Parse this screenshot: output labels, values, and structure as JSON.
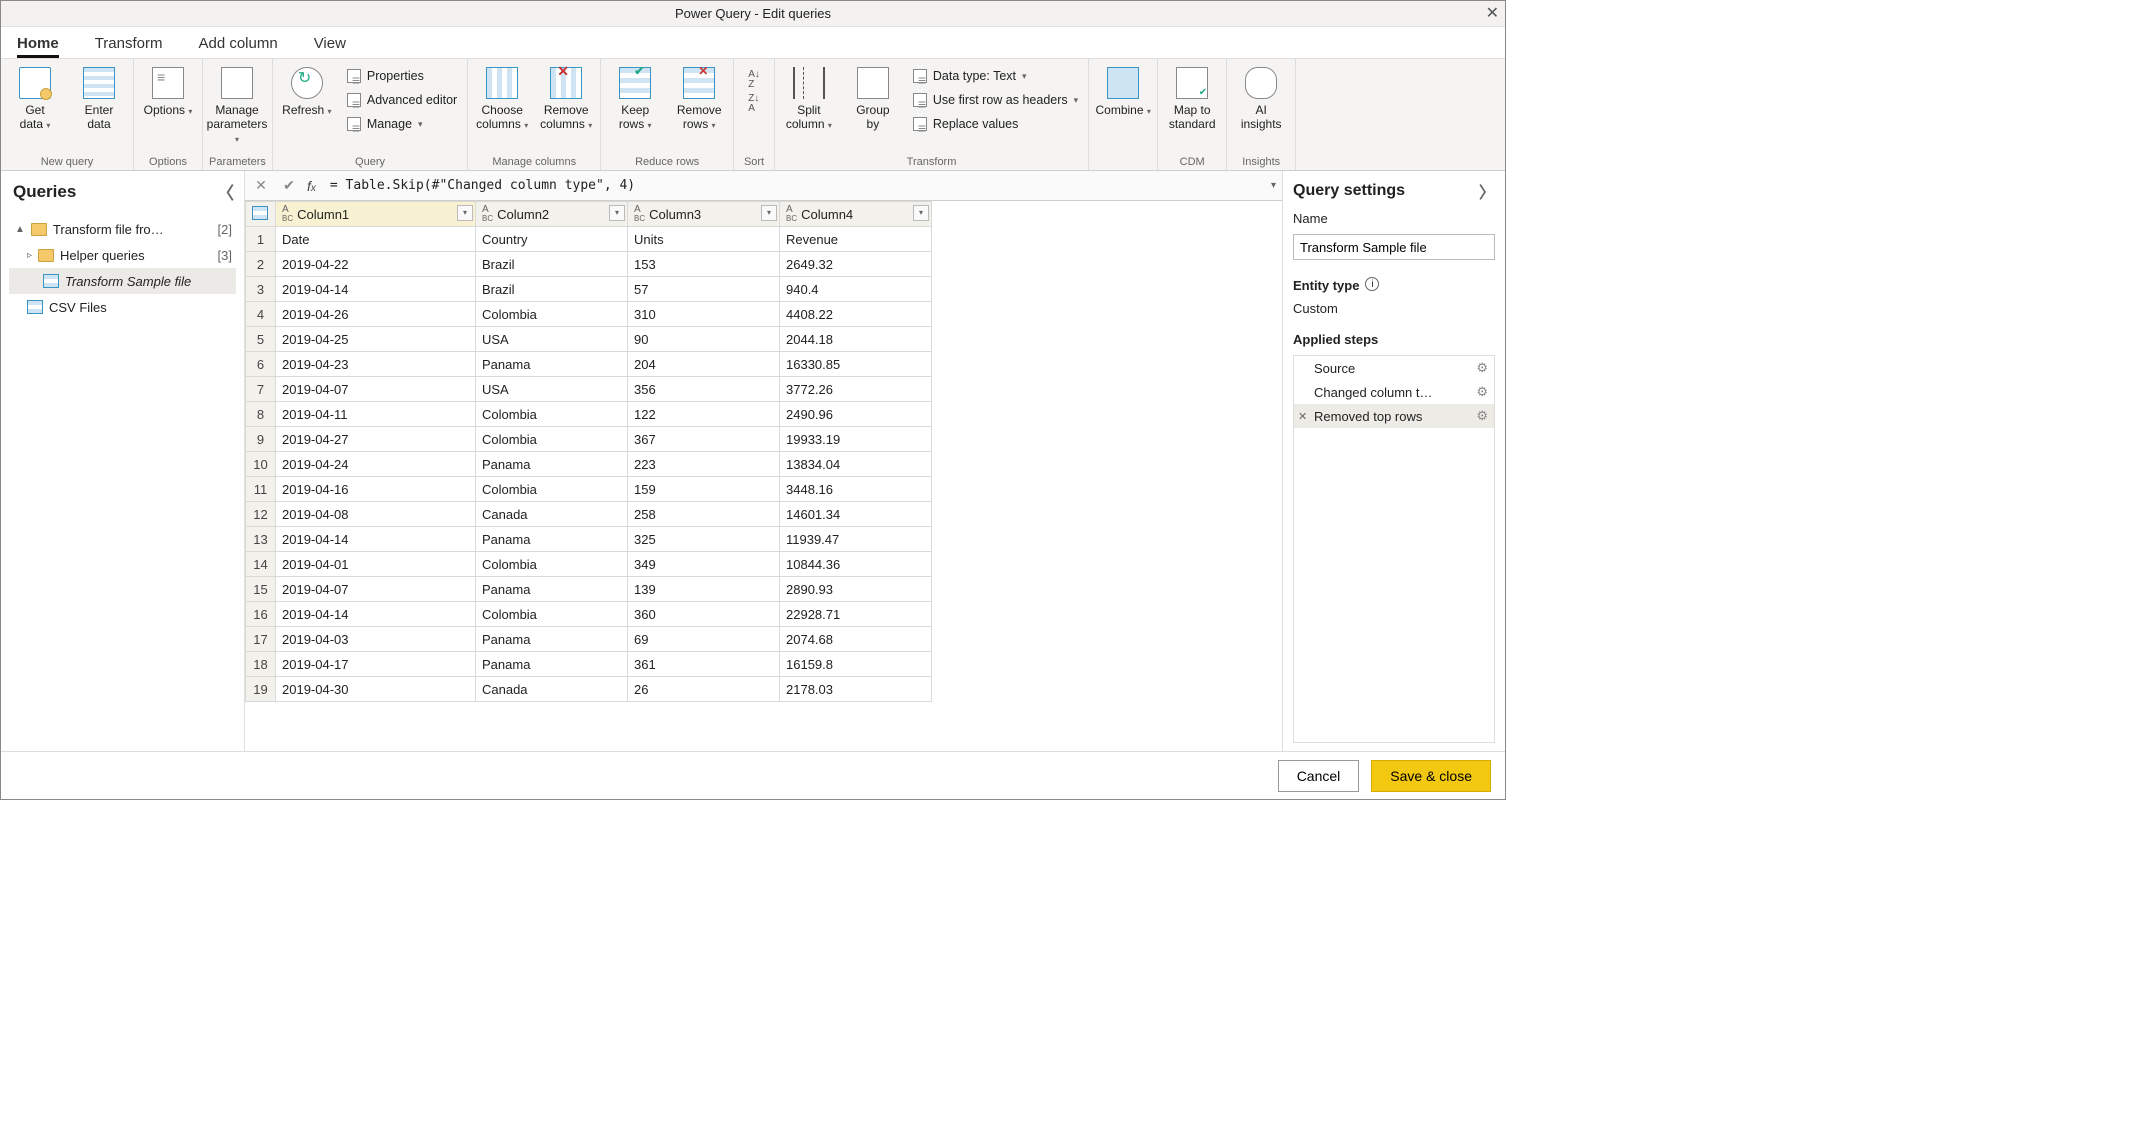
{
  "title": "Power Query - Edit queries",
  "tabs": [
    "Home",
    "Transform",
    "Add column",
    "View"
  ],
  "active_tab": 0,
  "ribbon": {
    "groups": [
      {
        "label": "New query",
        "buttons_lg": [
          {
            "name": "get-data",
            "label": "Get\ndata",
            "chev": true,
            "icon": "ic-db"
          },
          {
            "name": "enter-data",
            "label": "Enter\ndata",
            "icon": "ic-grid"
          }
        ]
      },
      {
        "label": "Options",
        "buttons_lg": [
          {
            "name": "options",
            "label": "Options",
            "chev": true,
            "icon": "ic-doc"
          }
        ]
      },
      {
        "label": "Parameters",
        "buttons_lg": [
          {
            "name": "manage-parameters",
            "label": "Manage\nparameters",
            "chev": true,
            "icon": "ic-sliders"
          }
        ]
      },
      {
        "label": "Query",
        "buttons_lg": [
          {
            "name": "refresh",
            "label": "Refresh",
            "chev": true,
            "icon": "ic-refresh"
          }
        ],
        "buttons_sm": [
          {
            "name": "properties",
            "label": "Properties"
          },
          {
            "name": "advanced-editor",
            "label": "Advanced editor"
          },
          {
            "name": "manage",
            "label": "Manage",
            "chev": true
          }
        ]
      },
      {
        "label": "Manage columns",
        "buttons_lg": [
          {
            "name": "choose-columns",
            "label": "Choose\ncolumns",
            "chev": true,
            "icon": "ic-col"
          },
          {
            "name": "remove-columns",
            "label": "Remove\ncolumns",
            "chev": true,
            "icon": "ic-colx"
          }
        ]
      },
      {
        "label": "Reduce rows",
        "buttons_lg": [
          {
            "name": "keep-rows",
            "label": "Keep\nrows",
            "chev": true,
            "icon": "ic-rows keep"
          },
          {
            "name": "remove-rows",
            "label": "Remove\nrows",
            "chev": true,
            "icon": "ic-rows rem"
          }
        ]
      },
      {
        "label": "Sort",
        "sort": true
      },
      {
        "label": "Transform",
        "buttons_lg": [
          {
            "name": "split-column",
            "label": "Split\ncolumn",
            "chev": true,
            "icon": "ic-split"
          },
          {
            "name": "group-by",
            "label": "Group\nby",
            "icon": "ic-group"
          }
        ],
        "buttons_sm": [
          {
            "name": "data-type",
            "label": "Data type: Text",
            "chev": true
          },
          {
            "name": "use-first-row",
            "label": "Use first row as headers",
            "chev": true
          },
          {
            "name": "replace-values",
            "label": "Replace values"
          }
        ]
      },
      {
        "label": "",
        "buttons_lg": [
          {
            "name": "combine",
            "label": "Combine",
            "chev": true,
            "icon": "ic-combine"
          }
        ]
      },
      {
        "label": "CDM",
        "buttons_lg": [
          {
            "name": "map-to-standard",
            "label": "Map to\nstandard",
            "icon": "ic-map"
          }
        ]
      },
      {
        "label": "Insights",
        "buttons_lg": [
          {
            "name": "ai-insights",
            "label": "AI\ninsights",
            "icon": "ic-ai"
          }
        ]
      }
    ]
  },
  "queries_panel": {
    "title": "Queries",
    "items": [
      {
        "level": 0,
        "type": "folder",
        "label": "Transform file fro…",
        "count": "[2]",
        "exp": "▲"
      },
      {
        "level": 1,
        "type": "folder",
        "label": "Helper queries",
        "count": "[3]",
        "exp": "▹"
      },
      {
        "level": 2,
        "type": "table",
        "label": "Transform Sample file",
        "sel": true
      },
      {
        "level": 1,
        "type": "table",
        "label": "CSV Files"
      }
    ]
  },
  "formula": "= Table.Skip(#\"Changed column type\", 4)",
  "columns": [
    "Column1",
    "Column2",
    "Column3",
    "Column4"
  ],
  "rows": [
    [
      "Date",
      "Country",
      "Units",
      "Revenue"
    ],
    [
      "2019-04-22",
      "Brazil",
      "153",
      "2649.32"
    ],
    [
      "2019-04-14",
      "Brazil",
      "57",
      "940.4"
    ],
    [
      "2019-04-26",
      "Colombia",
      "310",
      "4408.22"
    ],
    [
      "2019-04-25",
      "USA",
      "90",
      "2044.18"
    ],
    [
      "2019-04-23",
      "Panama",
      "204",
      "16330.85"
    ],
    [
      "2019-04-07",
      "USA",
      "356",
      "3772.26"
    ],
    [
      "2019-04-11",
      "Colombia",
      "122",
      "2490.96"
    ],
    [
      "2019-04-27",
      "Colombia",
      "367",
      "19933.19"
    ],
    [
      "2019-04-24",
      "Panama",
      "223",
      "13834.04"
    ],
    [
      "2019-04-16",
      "Colombia",
      "159",
      "3448.16"
    ],
    [
      "2019-04-08",
      "Canada",
      "258",
      "14601.34"
    ],
    [
      "2019-04-14",
      "Panama",
      "325",
      "11939.47"
    ],
    [
      "2019-04-01",
      "Colombia",
      "349",
      "10844.36"
    ],
    [
      "2019-04-07",
      "Panama",
      "139",
      "2890.93"
    ],
    [
      "2019-04-14",
      "Colombia",
      "360",
      "22928.71"
    ],
    [
      "2019-04-03",
      "Panama",
      "69",
      "2074.68"
    ],
    [
      "2019-04-17",
      "Panama",
      "361",
      "16159.8"
    ],
    [
      "2019-04-30",
      "Canada",
      "26",
      "2178.03"
    ]
  ],
  "settings": {
    "title": "Query settings",
    "name_label": "Name",
    "name_value": "Transform Sample file",
    "entity_label": "Entity type",
    "entity_value": "Custom",
    "steps_label": "Applied steps",
    "steps": [
      {
        "label": "Source",
        "gear": true
      },
      {
        "label": "Changed column t…",
        "gear": true
      },
      {
        "label": "Removed top rows",
        "gear": true,
        "sel": true,
        "del": true
      }
    ]
  },
  "footer": {
    "cancel": "Cancel",
    "save": "Save & close"
  }
}
